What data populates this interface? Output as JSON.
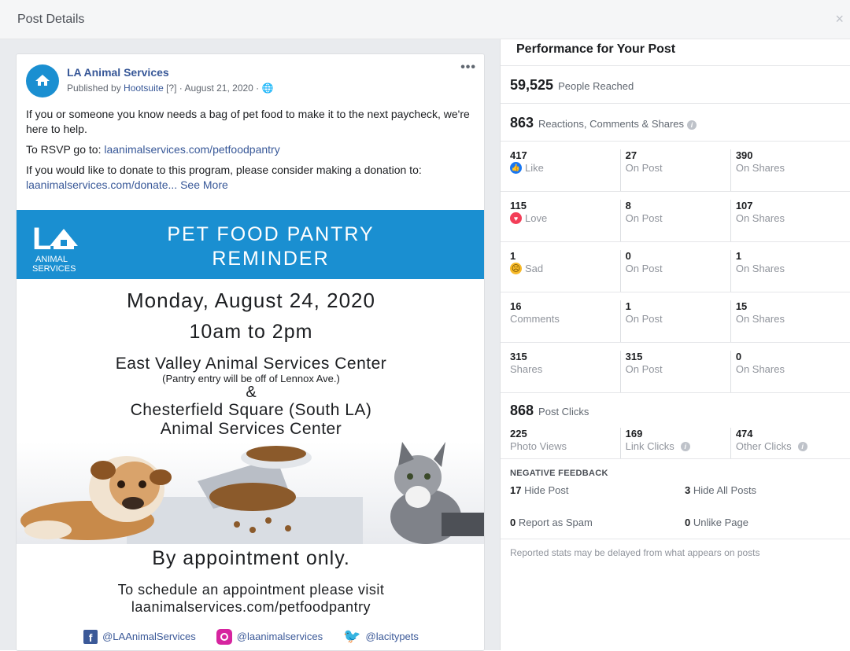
{
  "header": {
    "title": "Post Details",
    "close": "×"
  },
  "post": {
    "page_name": "LA Animal Services",
    "published_by_prefix": "Published by ",
    "published_by": "Hootsuite",
    "help_marker": "[?]",
    "date": " · August 21, 2020 · ",
    "more": "•••",
    "p1": "If you or someone you know needs a bag of pet food to make it to the next paycheck, we're here to help.",
    "p2_prefix": "To RSVP go to: ",
    "p2_link": "laanimalservices.com/petfoodpantry",
    "p3_prefix": "If you would like to donate to this program, please consider making a donation to: ",
    "p3_link": "laanimalservices.com/donate...",
    "see_more": "See More",
    "logo_text": "ANIMAL SERVICES"
  },
  "flyer": {
    "logo_l1": "ANIMAL",
    "logo_l2": "SERVICES",
    "banner_l1": "PET FOOD PANTRY",
    "banner_l2": "REMINDER",
    "date": "Monday, August 24, 2020",
    "time": "10am to 2pm",
    "loc1": "East Valley Animal Services Center",
    "loc1_sub": "(Pantry entry will be off of Lennox Ave.)",
    "amp": "&",
    "loc2_l1": "Chesterfield Square (South LA)",
    "loc2_l2": "Animal Services Center",
    "appt": "By appointment only.",
    "sched_l1": "To schedule an appointment please visit",
    "sched_l2": "laanimalservices.com/petfoodpantry",
    "fb": "@LAAnimalServices",
    "ig": "@laanimalservices",
    "tw": "@lacitypets"
  },
  "performance": {
    "title": "Performance for Your Post",
    "reached_num": "59,525",
    "reached_label": "People Reached",
    "rcs_num": "863",
    "rcs_label": "Reactions, Comments & Shares",
    "rows": [
      {
        "n1": "417",
        "l1": "Like",
        "n2": "27",
        "l2": "On Post",
        "n3": "390",
        "l3": "On Shares"
      },
      {
        "n1": "115",
        "l1": "Love",
        "n2": "8",
        "l2": "On Post",
        "n3": "107",
        "l3": "On Shares"
      },
      {
        "n1": "1",
        "l1": "Sad",
        "n2": "0",
        "l2": "On Post",
        "n3": "1",
        "l3": "On Shares"
      },
      {
        "n1": "16",
        "l1": "Comments",
        "n2": "1",
        "l2": "On Post",
        "n3": "15",
        "l3": "On Shares"
      },
      {
        "n1": "315",
        "l1": "Shares",
        "n2": "315",
        "l2": "On Post",
        "n3": "0",
        "l3": "On Shares"
      }
    ],
    "clicks_num": "868",
    "clicks_label": "Post Clicks",
    "clicks": {
      "n1": "225",
      "l1": "Photo Views",
      "n2": "169",
      "l2": "Link Clicks",
      "n3": "474",
      "l3": "Other Clicks"
    },
    "neg_title": "NEGATIVE FEEDBACK",
    "neg": [
      {
        "n": "17",
        "l": "Hide Post"
      },
      {
        "n": "3",
        "l": "Hide All Posts"
      },
      {
        "n": "0",
        "l": "Report as Spam"
      },
      {
        "n": "0",
        "l": "Unlike Page"
      }
    ],
    "note": "Reported stats may be delayed from what appears on posts"
  }
}
